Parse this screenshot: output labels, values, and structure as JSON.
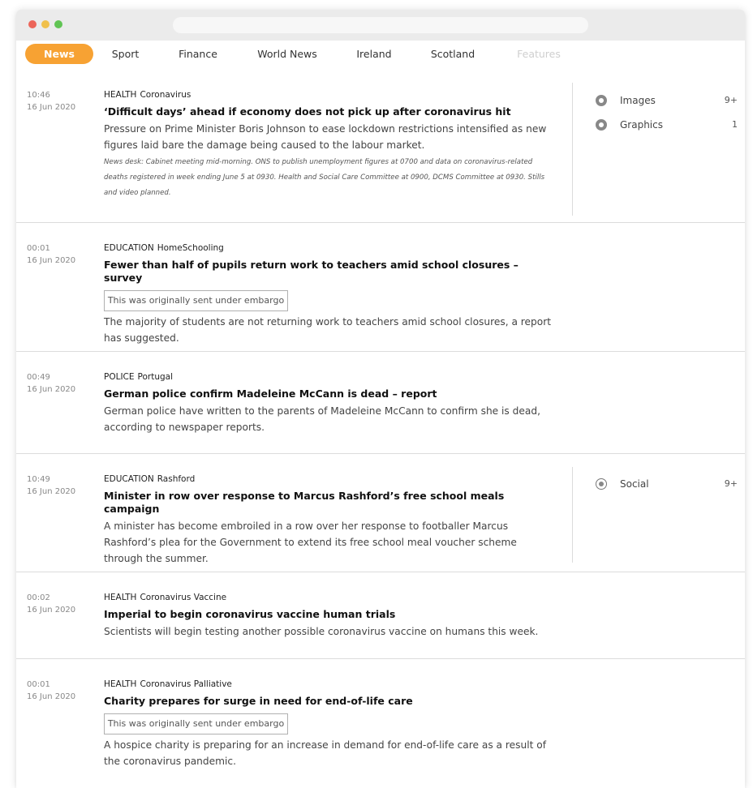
{
  "tabs": [
    {
      "label": "News",
      "state": "active"
    },
    {
      "label": "Sport",
      "state": "normal"
    },
    {
      "label": "Finance",
      "state": "normal"
    },
    {
      "label": "World News",
      "state": "normal"
    },
    {
      "label": "Ireland",
      "state": "normal"
    },
    {
      "label": "Scotland",
      "state": "normal"
    },
    {
      "label": "Features",
      "state": "disabled"
    }
  ],
  "colors": {
    "accent": "#f7a233",
    "divider": "#dcdcdc"
  },
  "items": [
    {
      "time": "10:46",
      "date": "16 Jun 2020",
      "category": "HEALTH",
      "topic": "Coronavirus",
      "title": "‘Difficult days’ ahead if economy does not pick up after coronavirus hit",
      "summary": "Pressure on Prime Minister Boris Johnson to ease lockdown restrictions intensified as new figures laid bare the damage being caused to the labour market.",
      "note": "News desk: Cabinet meeting mid-morning. ONS to publish unemployment figures at 0700 and data on coronavirus-related deaths registered in week ending June 5 at 0930. Health and Social Care Committee at 0900, DCMS Committee at 0930. Stills and video planned.",
      "side": [
        {
          "label": "Images",
          "count": "9+",
          "icon": "image-icon"
        },
        {
          "label": "Graphics",
          "count": "1",
          "icon": "graphics-icon"
        }
      ]
    },
    {
      "time": "00:01",
      "date": "16 Jun 2020",
      "category": "EDUCATION",
      "topic": "HomeSchooling",
      "title": "Fewer than half of pupils return work to teachers amid school closures – survey",
      "embargo": "This was originally sent under embargo",
      "summary": "The majority of students are not returning work to teachers amid school closures, a report has suggested."
    },
    {
      "time": "00:49",
      "date": "16 Jun 2020",
      "category": "POLICE",
      "topic": "Portugal",
      "title": "German police confirm Madeleine McCann is dead – report",
      "summary": "German police have written to the parents of Madeleine McCann to confirm she is dead, according to newspaper reports."
    },
    {
      "time": "10:49",
      "date": "16 Jun 2020",
      "category": "EDUCATION",
      "topic": "Rashford",
      "title": "Minister in row over response to Marcus Rashford’s free school meals campaign",
      "summary": "A minister has become embroiled in a row over her response to footballer Marcus Rashford’s plea for the Government to extend its free school meal voucher scheme through the summer.",
      "side": [
        {
          "label": "Social",
          "count": "9+",
          "icon": "social-icon"
        }
      ]
    },
    {
      "time": "00:02",
      "date": "16 Jun 2020",
      "category": "HEALTH",
      "topic": "Coronavirus Vaccine",
      "title": "Imperial to begin coronavirus vaccine human trials",
      "summary": "Scientists will begin testing another possible coronavirus vaccine on humans this week."
    },
    {
      "time": "00:01",
      "date": "16 Jun 2020",
      "category": "HEALTH",
      "topic": "Coronavirus Palliative",
      "title": "Charity prepares for surge in need for end-of-life care",
      "embargo": "This was originally sent under embargo",
      "summary": "A hospice charity is preparing for an increase in demand for end-of-life care as a result of the coronavirus pandemic."
    }
  ]
}
